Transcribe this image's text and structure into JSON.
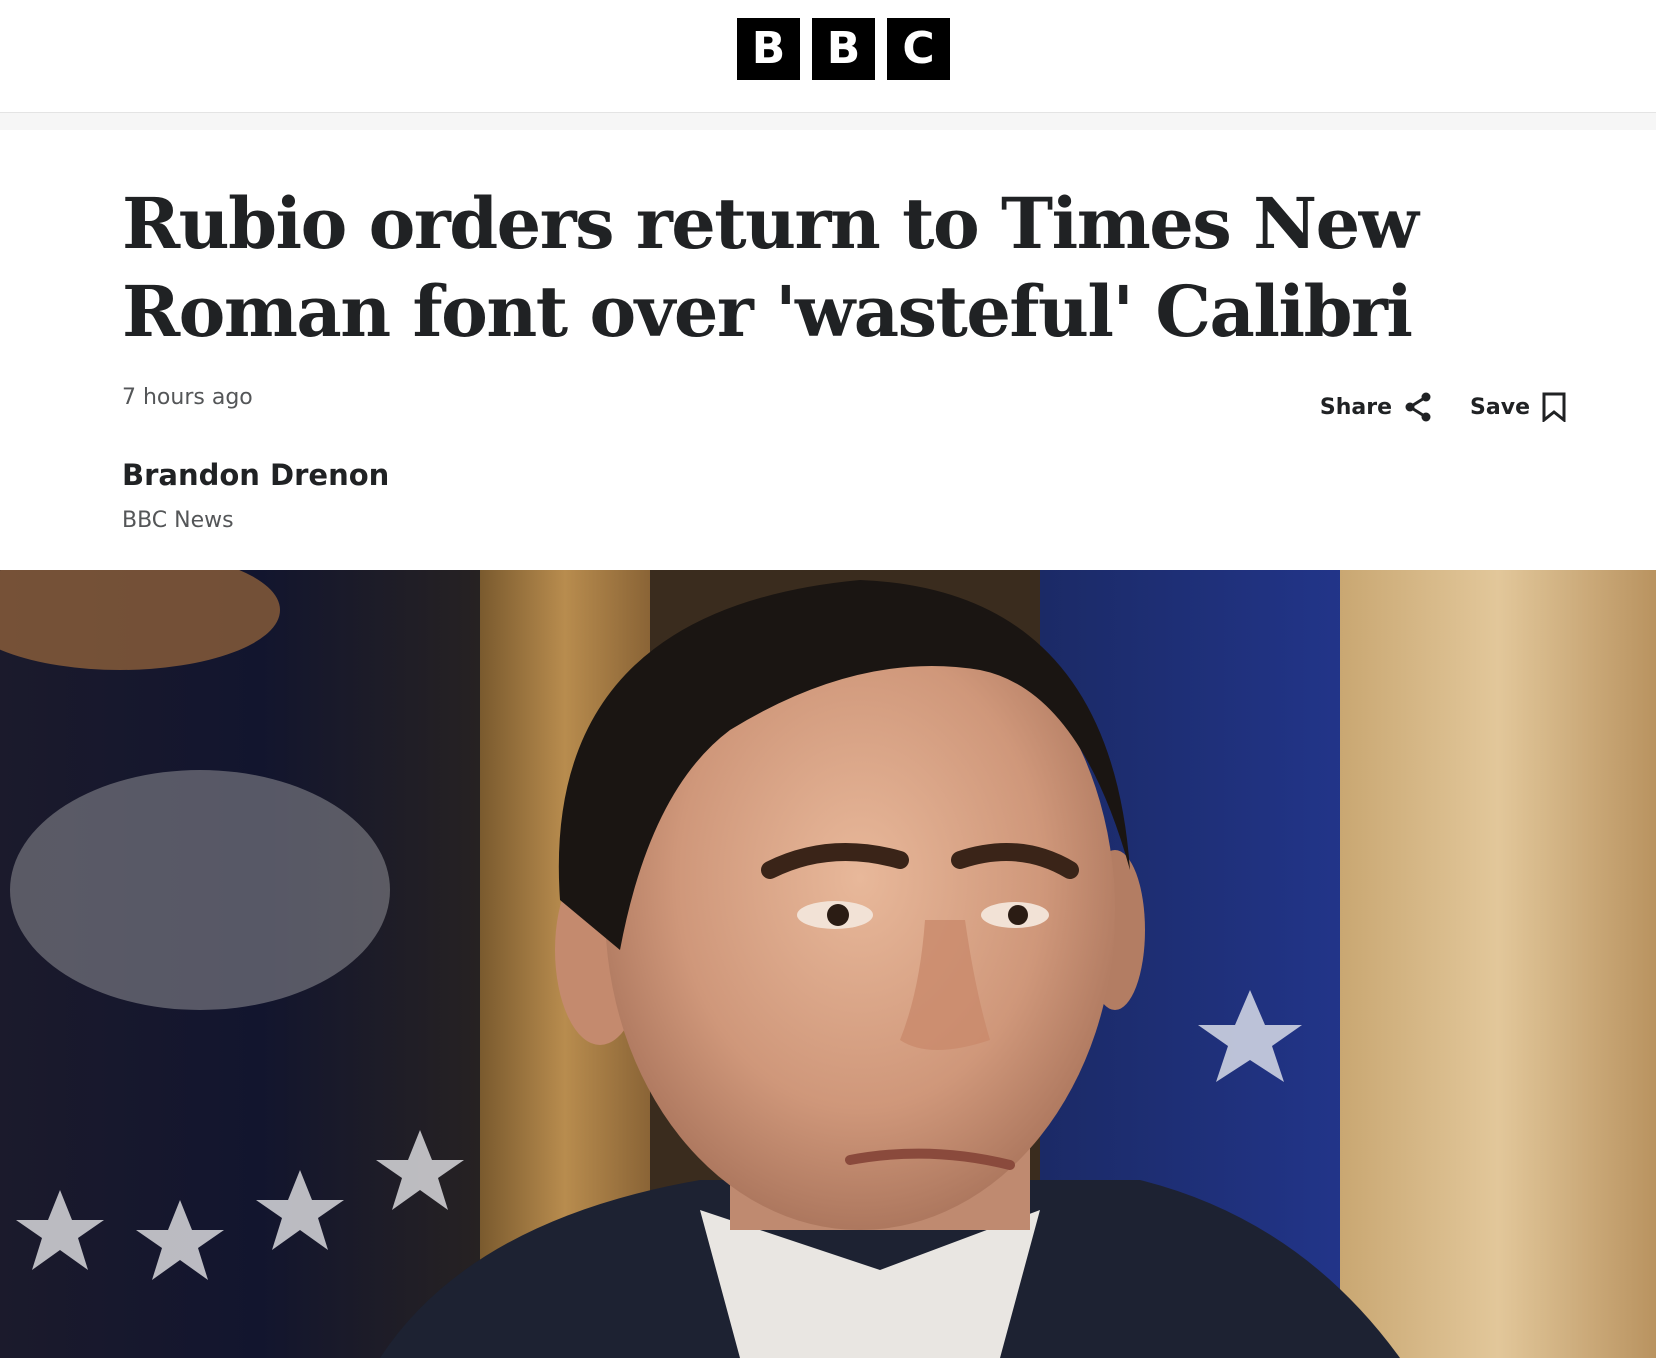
{
  "header": {
    "logo_letters": [
      "B",
      "B",
      "C"
    ]
  },
  "article": {
    "headline": "Rubio orders return to Times New Roman font over 'wasteful' Calibri",
    "timestamp": "7 hours ago",
    "author": "Brandon Drenon",
    "organization": "BBC News"
  },
  "actions": {
    "share_label": "Share",
    "save_label": "Save",
    "share_icon": "share-icon",
    "save_icon": "bookmark-icon"
  },
  "hero_image": {
    "description_icon": "hero-photo"
  },
  "colors": {
    "logo_bg": "#000000",
    "headline": "#202224",
    "meta": "#545658"
  }
}
